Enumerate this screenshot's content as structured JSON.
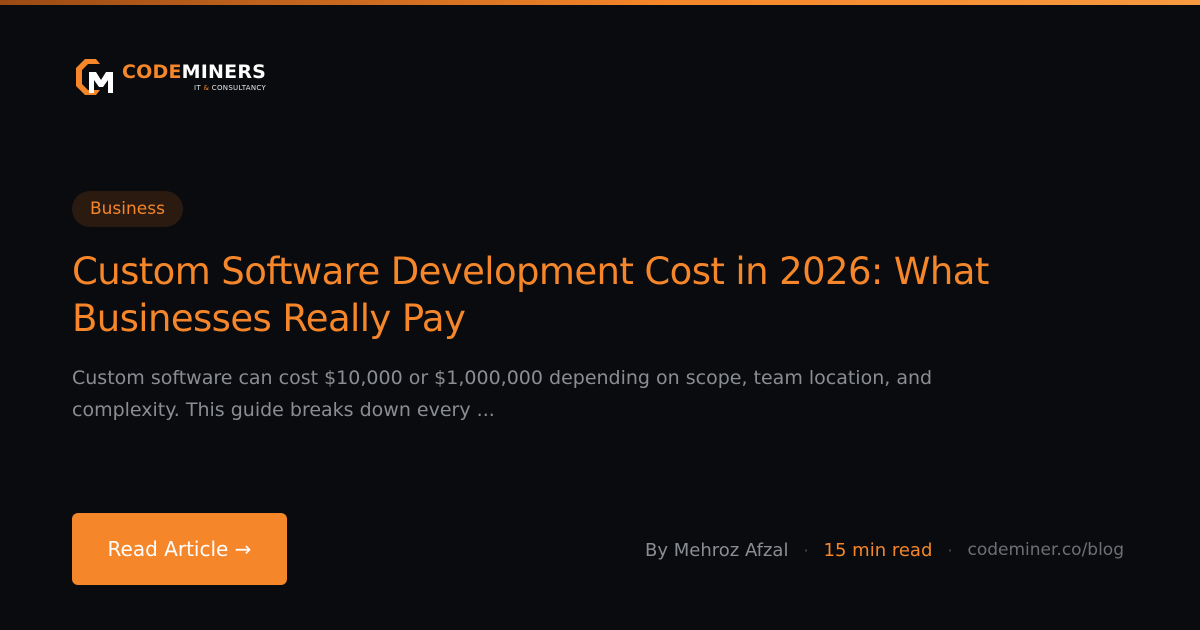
{
  "colors": {
    "accent": "#f5862a",
    "background": "#0a0b0e"
  },
  "brand": {
    "name_accent": "CODE",
    "name_rest": "MINERS",
    "tagline_left": "IT",
    "tagline_amp": "&",
    "tagline_right": "CONSULTANCY",
    "logo_icon": "cm-monogram-icon"
  },
  "post": {
    "category": "Business",
    "title": "Custom Software Development Cost in 2026: What Businesses Really Pay",
    "excerpt": "Custom software can cost $10,000 or $1,000,000 depending on scope, team location, and complexity. This guide breaks down every ..."
  },
  "cta": {
    "label": "Read Article →"
  },
  "meta": {
    "author": "By Mehroz Afzal",
    "separator": "·",
    "read_time": "15 min read",
    "url": "codeminer.co/blog"
  }
}
